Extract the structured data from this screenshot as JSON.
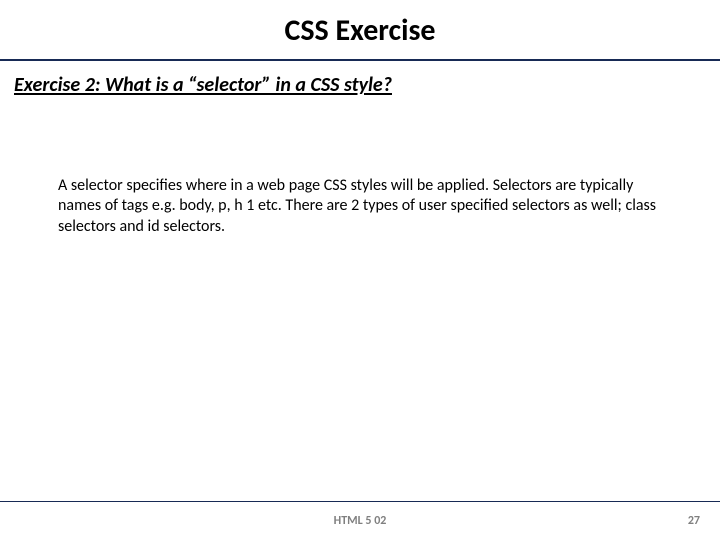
{
  "title": "CSS Exercise",
  "subtitle": "Exercise 2: What is a “selector” in a CSS style?",
  "body": "A selector specifies where in a web page CSS styles will be applied. Selectors are typically names of tags e.g. body, p, h 1 etc. There are 2 types of user specified selectors as well; class selectors and id selectors.",
  "footer": {
    "center": "HTML 5 02",
    "page": "27"
  }
}
